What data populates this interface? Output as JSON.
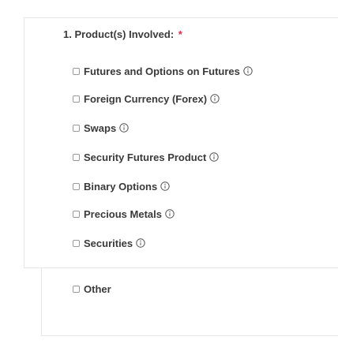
{
  "question": {
    "number": "1.",
    "label": "Product(s) Involved:",
    "required_mark": "*"
  },
  "options": [
    {
      "label": "Futures and Options on Futures",
      "info_icon": "info-icon"
    },
    {
      "label": "Foreign Currency (Forex)",
      "info_icon": "info-icon"
    },
    {
      "label": "Swaps",
      "info_icon": "info-icon"
    },
    {
      "label": "Security Futures Product",
      "info_icon": "info-icon"
    },
    {
      "label": "Binary Options",
      "info_icon": "info-icon"
    },
    {
      "label": "Precious Metals",
      "info_icon": "info-icon"
    },
    {
      "label": "Securities",
      "info_icon": "info-icon"
    }
  ],
  "other": {
    "label": "Other"
  },
  "colors": {
    "text": "#3a3a3a",
    "required": "#e8294a",
    "border": "#e6e6e6"
  }
}
